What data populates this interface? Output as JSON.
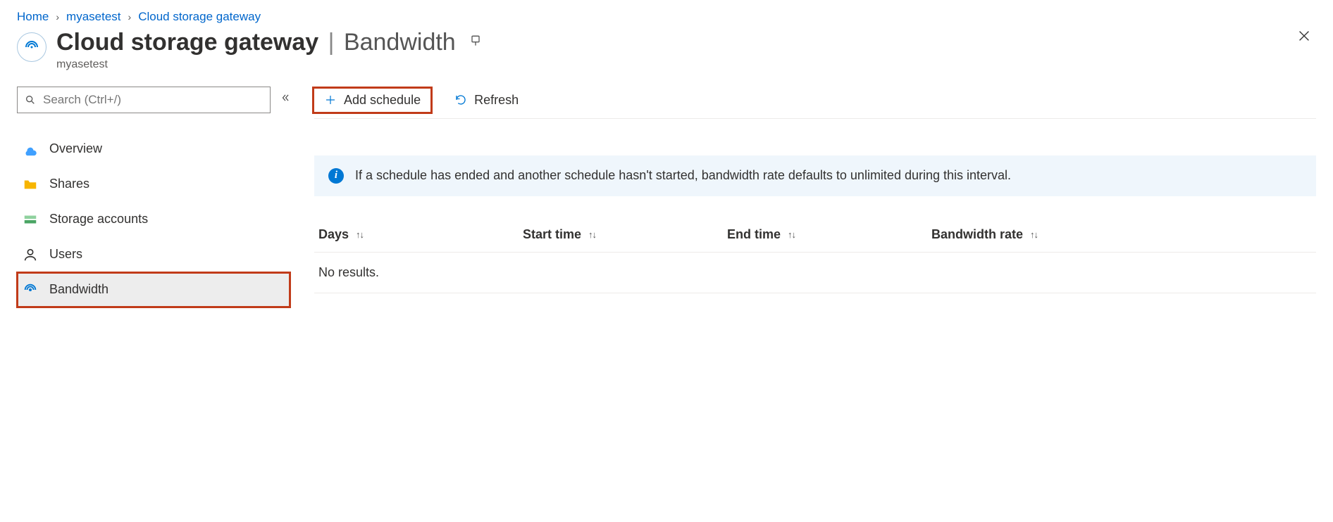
{
  "breadcrumb": {
    "home": "Home",
    "resource": "myasetest",
    "current": "Cloud storage gateway"
  },
  "header": {
    "title": "Cloud storage gateway",
    "section": "Bandwidth",
    "subtitle": "myasetest"
  },
  "sidebar": {
    "search_placeholder": "Search (Ctrl+/)",
    "items": [
      {
        "label": "Overview"
      },
      {
        "label": "Shares"
      },
      {
        "label": "Storage accounts"
      },
      {
        "label": "Users"
      },
      {
        "label": "Bandwidth"
      }
    ]
  },
  "toolbar": {
    "add_schedule": "Add schedule",
    "refresh": "Refresh"
  },
  "info": {
    "text": "If a schedule has ended and another schedule hasn't started, bandwidth rate defaults to unlimited during this interval."
  },
  "table": {
    "columns": {
      "days": "Days",
      "start": "Start time",
      "end": "End time",
      "rate": "Bandwidth rate"
    },
    "empty": "No results."
  }
}
